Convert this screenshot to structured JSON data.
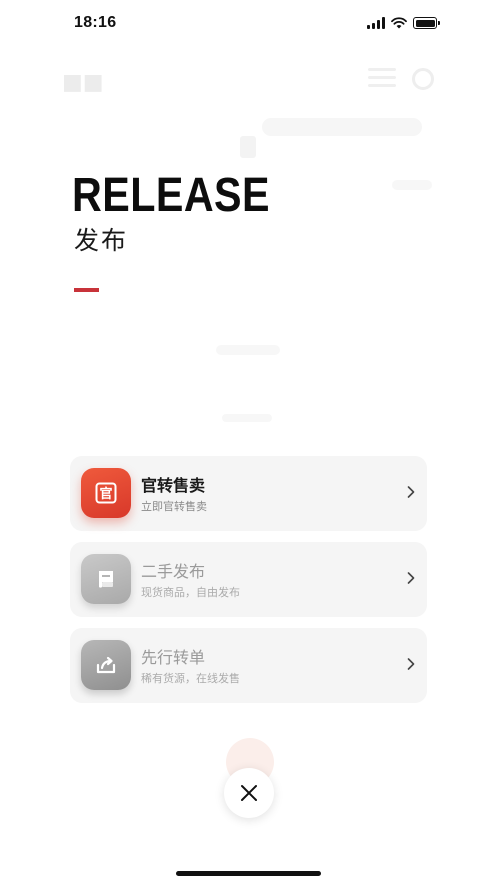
{
  "status_bar": {
    "time": "18:16"
  },
  "hero": {
    "title": "RELEASE",
    "subtitle": "发布"
  },
  "options": [
    {
      "title": "官转售卖",
      "subtitle": "立即官转售卖",
      "icon": "official-badge-icon",
      "icon_glyph": "官"
    },
    {
      "title": "二手发布",
      "subtitle": "现货商品，自由发布",
      "icon": "scroll-icon"
    },
    {
      "title": "先行转单",
      "subtitle": "稀有货源，在线发售",
      "icon": "share-forward-icon"
    }
  ],
  "colors": {
    "accent": "#c8333a",
    "card_bg": "#f5f5f5",
    "icon_red": "#e4482f"
  }
}
